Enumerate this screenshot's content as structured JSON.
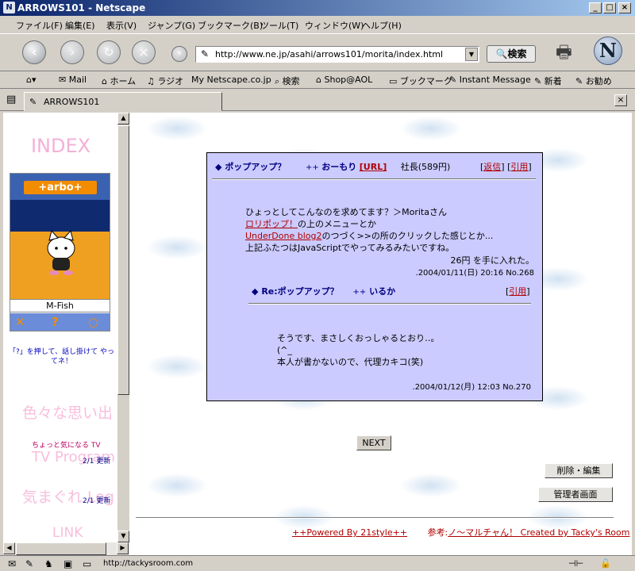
{
  "window": {
    "title": "ARROWS101 - Netscape",
    "app_icon": "N"
  },
  "menu": [
    "ファイル(F)",
    "編集(E)",
    "表示(V)",
    "ジャンプ(G)",
    "ブックマーク(B)",
    "ツール(T)",
    "ウィンドウ(W)",
    "ヘルプ(H)"
  ],
  "toolbar": {
    "url": "http://www.ne.jp/asahi/arrows101/morita/index.html",
    "search_label": "検索",
    "logo": "N"
  },
  "personal": [
    "Mail",
    "ホーム",
    "ラジオ",
    "Netscape.co.jp",
    "検索",
    "Shop@AOL",
    "ブックマーク",
    "Instant Message",
    "新着",
    "お勧め"
  ],
  "tab": {
    "label": "ARROWS101"
  },
  "left": {
    "index_heading": "INDEX",
    "game_logo": "+arbo+",
    "game_character": "M-Fish",
    "hint": "「?」を押して、話し掛けて やってネ！",
    "memories": "色々な思い出",
    "tv_note": "ちょっと気になる TV",
    "tv_program": "TV Program",
    "tv_date": "2/1",
    "tv_updated": "更新",
    "kimagure": "気まぐれ Log",
    "k_date": "2/1",
    "k_updated": "更新",
    "link": "LINK"
  },
  "post": {
    "title": "ポップアップ？",
    "author_prefix": "++",
    "author": "おーもり",
    "url_tag": "[URL]",
    "rank": "社長(589円)",
    "reply_link": "返信",
    "quote_link": "引用",
    "line1": "ひょっとしてこんなのを求めてます？＞Moritaさん",
    "link_lollipop": "ロリポップ！",
    "line2_rest": "の上のメニューとか",
    "link_underdone": "UnderDone blog2",
    "line3_rest": "のつづく>>の所のクリックした感じとか...",
    "line4": "上記ふたつはJavaScriptでやってみるみたいですね。",
    "reward": "26円 を手に入れた。",
    "date": ".2004/01/11(日) 20:16 No.268"
  },
  "reply": {
    "title": "Re:ポップアップ？",
    "author_prefix": "++",
    "author": "いるか",
    "quote_link": "引用",
    "line1": "そうです、まさしくおっしゃるとおり‥。",
    "line2": "(^_",
    "line3": "本人が書かないので、代理カキコ(笑)",
    "date": ".2004/01/12(月) 12:03 No.270"
  },
  "buttons": {
    "next": "NEXT",
    "delete_edit": "削除・編集",
    "admin": "管理者画面"
  },
  "footer": {
    "powered": "++Powered By 21style++",
    "credit_prefix": "参考:",
    "credit": "ノ〜マルチャん！ Created by Tacky's Room"
  },
  "status": {
    "text": "http://tackysroom.com"
  }
}
